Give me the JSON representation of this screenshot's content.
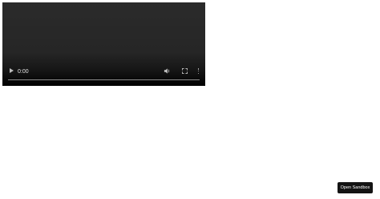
{
  "video": {
    "time": "0:00",
    "progress": 0
  },
  "controls_icons": [
    "play-icon",
    "volume-icon",
    "fullscreen-icon",
    "more-options-icon"
  ],
  "sandbox": {
    "button_label": "Open Sandbox"
  }
}
